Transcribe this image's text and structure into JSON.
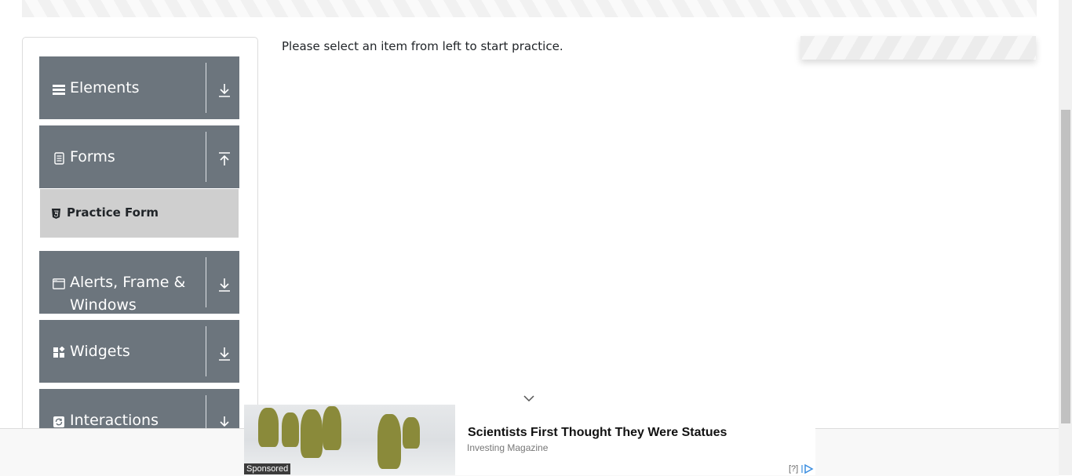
{
  "main": {
    "message": "Please select an item from left to start practice."
  },
  "menu": {
    "groups": [
      {
        "label": "Elements",
        "icon": "hamburger-icon",
        "arrow": "download-arrow-icon"
      },
      {
        "label": "Forms",
        "icon": "document-icon",
        "arrow": "upload-arrow-icon",
        "expanded": true
      },
      {
        "label": "Alerts, Frame & Windows",
        "icon": "window-icon",
        "arrow": "download-arrow-icon"
      },
      {
        "label": "Widgets",
        "icon": "widgets-icon",
        "arrow": "download-arrow-icon"
      },
      {
        "label": "Interactions",
        "icon": "refresh-icon",
        "arrow": "download-arrow-icon"
      }
    ],
    "forms_items": [
      {
        "label": "Practice Form",
        "icon": "html5-icon"
      }
    ]
  },
  "ad": {
    "sponsored_label": "Sponsored",
    "headline": "Scientists First Thought They Were Statues",
    "source": "Investing Magazine",
    "help_label": "[?]"
  },
  "colors": {
    "group_bg": "#6c757d",
    "sub_item_bg": "#cfcfcf"
  }
}
